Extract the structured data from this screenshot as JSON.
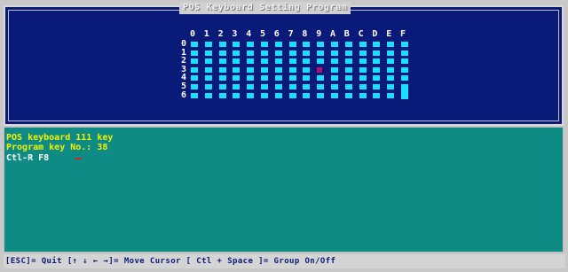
{
  "window": {
    "title": "POS Keyboard Setting Program"
  },
  "grid": {
    "columns": [
      "0",
      "1",
      "2",
      "3",
      "4",
      "5",
      "6",
      "7",
      "8",
      "9",
      "A",
      "B",
      "C",
      "D",
      "E",
      "F"
    ],
    "rows": [
      "0",
      "1",
      "2",
      "3",
      "4",
      "5",
      "6"
    ],
    "selected_key": {
      "row": 3,
      "col": 9
    },
    "tall_key": {
      "rows": "5-6",
      "col": 15
    },
    "key_color": "#19e0ff",
    "selected_color": "#b0126f"
  },
  "status": {
    "line1": "POS keyboard 111 key",
    "line2": "Program key No.: 38",
    "line3_prefix": "Ctl-R  F8"
  },
  "help": {
    "text": "[ESC]= Quit   [↑ ↓ ← →]= Move Cursor   [ Ctl + Space ]= Group On/Off"
  },
  "colors": {
    "top_background": "#0a1a78",
    "status_background": "#0f8b86",
    "status_text_yellow": "#f4f000"
  }
}
